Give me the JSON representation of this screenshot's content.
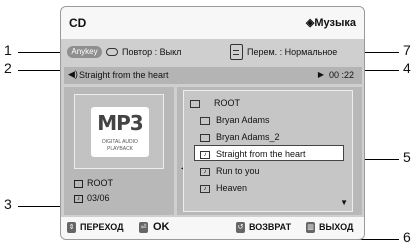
{
  "header": {
    "title": "CD",
    "mode": "◈Музыка"
  },
  "options": {
    "pill_label": "Anykey",
    "repeat_label": "Повтор : Выкл",
    "shuffle_label": "Перем. : Нормальное"
  },
  "now_playing": {
    "speaker_icon": "speaker-icon",
    "track": "Straight from the heart",
    "play_glyph": "▶",
    "time": "00 :22"
  },
  "info": {
    "logo_main": "MP3",
    "logo_sub": "DIGITAL AUDIO PLAYBACK",
    "folder": "ROOT",
    "position": "03/06"
  },
  "files": [
    {
      "name": "ROOT",
      "icon": "folder-open-icon",
      "glyph": ""
    },
    {
      "name": "Bryan Adams",
      "icon": "folder-icon",
      "glyph": ""
    },
    {
      "name": "Bryan Adams_2",
      "icon": "folder-icon",
      "glyph": ""
    },
    {
      "name": "Straight from the heart",
      "icon": "music-note-icon",
      "glyph": "♪"
    },
    {
      "name": "Run to you",
      "icon": "music-note-icon",
      "glyph": "♪"
    },
    {
      "name": "Heaven",
      "icon": "music-note-icon",
      "glyph": "♪"
    }
  ],
  "selected_marker": "◀",
  "scroll_glyph": "▼",
  "footer": {
    "move_icon": "⇕",
    "move_label": "ПЕРЕХОД",
    "ok_icon": "⏎",
    "ok_label": "OK",
    "back_icon": "↺",
    "back_label": "ВОЗВРАТ",
    "exit_icon": "▥",
    "exit_label": "ВЫХОД"
  },
  "callouts": [
    "1",
    "2",
    "3",
    "4",
    "5",
    "6",
    "7"
  ]
}
